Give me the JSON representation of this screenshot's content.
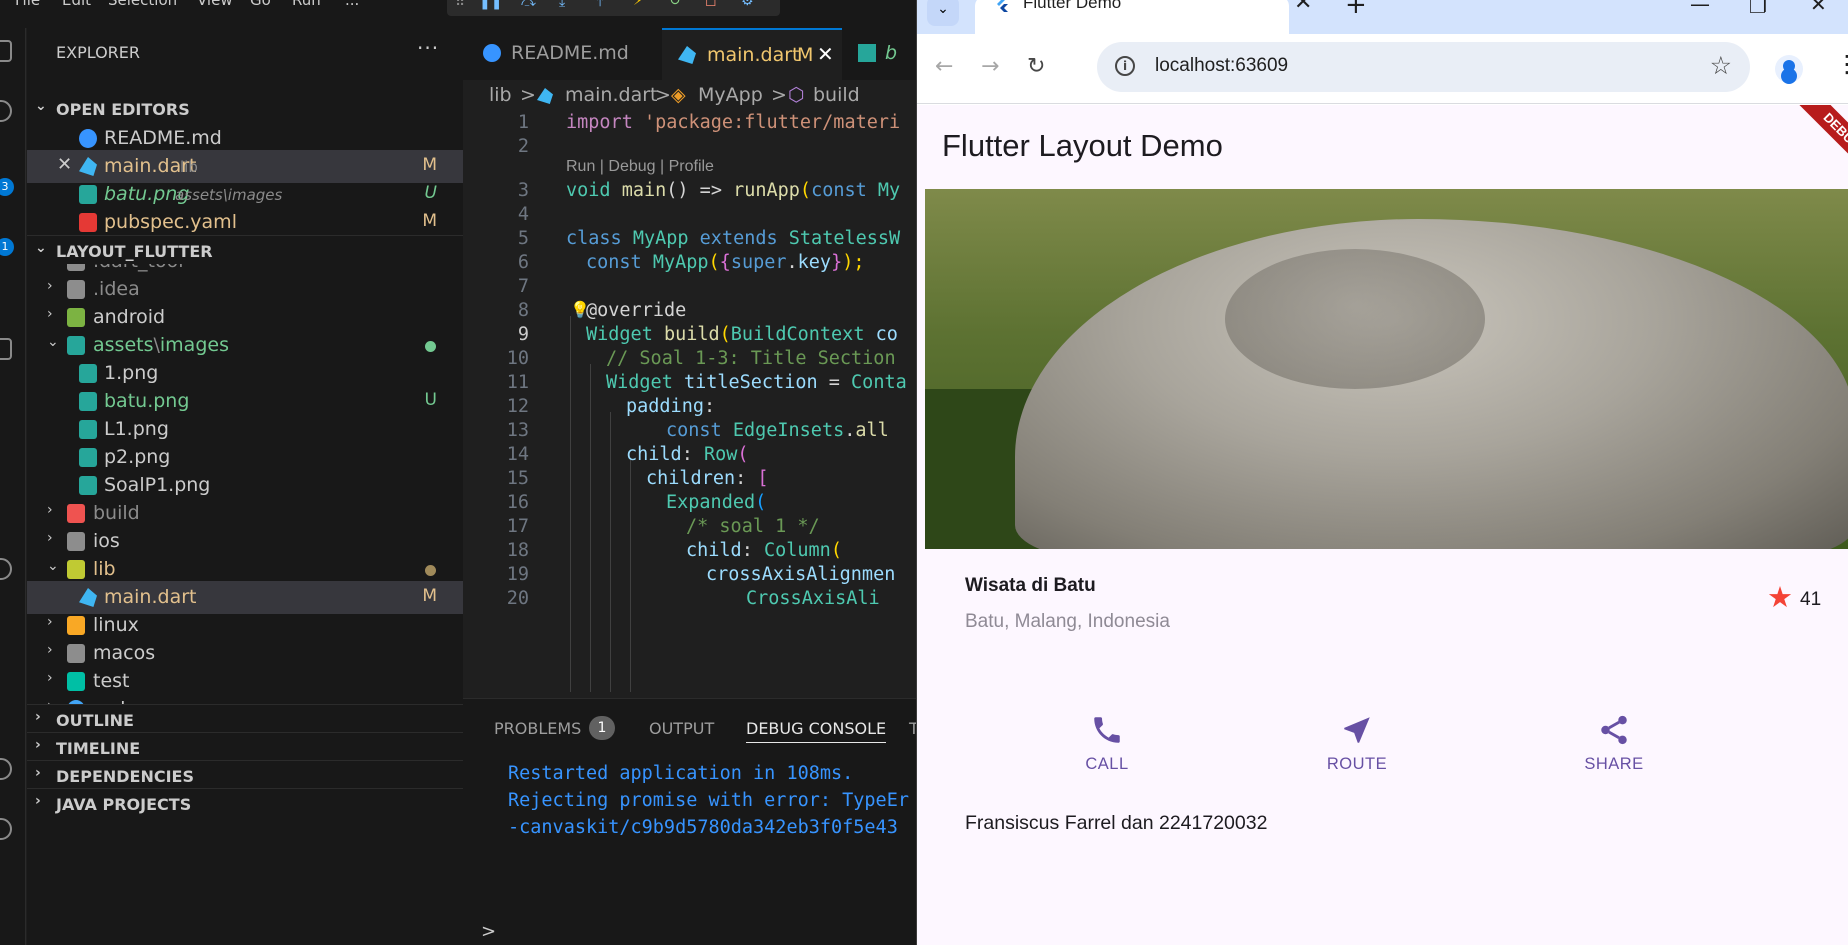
{
  "vscode": {
    "menu": [
      "File",
      "Edit",
      "Selection",
      "View",
      "Go",
      "Run",
      "..."
    ],
    "activity_badges": [
      "3",
      "1"
    ],
    "explorer_title": "EXPLORER",
    "explorer_more": "···",
    "open_editors": {
      "label": "OPEN EDITORS",
      "items": [
        {
          "name": "README.md",
          "desc": "",
          "status": "",
          "icon": "info-icon"
        },
        {
          "name": "main.dart",
          "desc": "lib",
          "status": "M",
          "icon": "dart-icon"
        },
        {
          "name": "batu.png",
          "desc": "assets\\images",
          "status": "U",
          "icon": "image-icon"
        },
        {
          "name": "pubspec.yaml",
          "desc": "",
          "status": "M",
          "icon": "yaml-icon"
        }
      ]
    },
    "project": {
      "label": "LAYOUT_FLUTTER",
      "items": [
        {
          "name": ".dart_tool"
        },
        {
          "name": ".idea"
        },
        {
          "name": "android"
        },
        {
          "name": "assets",
          "sep": "\\",
          "sub": "images"
        },
        {
          "name": "1.png"
        },
        {
          "name": "batu.png",
          "status": "U"
        },
        {
          "name": "L1.png"
        },
        {
          "name": "p2.png"
        },
        {
          "name": "SoalP1.png"
        },
        {
          "name": "build"
        },
        {
          "name": "ios"
        },
        {
          "name": "lib"
        },
        {
          "name": "main.dart",
          "status": "M"
        },
        {
          "name": "linux"
        },
        {
          "name": "macos"
        },
        {
          "name": "test"
        },
        {
          "name": "web"
        }
      ]
    },
    "bottom_sections": [
      "OUTLINE",
      "TIMELINE",
      "DEPENDENCIES",
      "JAVA PROJECTS"
    ],
    "tabs": [
      {
        "label": "README.md"
      },
      {
        "label": "main.dart",
        "status": "M"
      },
      {
        "label": "b"
      }
    ],
    "breadcrumb": [
      "lib",
      ">",
      "main.dart",
      ">",
      "MyApp",
      ">",
      "build"
    ],
    "codelens": "Run | Debug | Profile",
    "line_numbers": [
      "1",
      "2",
      "3",
      "4",
      "5",
      "6",
      "7",
      "8",
      "9",
      "10",
      "11",
      "12",
      "13",
      "14",
      "15",
      "16",
      "17",
      "18",
      "19",
      "20"
    ],
    "code": {
      "l1_kw": "import",
      "l1_str": " 'package:flutter/materi",
      "l3_ty": "void",
      "l3_fn": " main",
      "l3_a": "() => ",
      "l3_fn2": "runApp",
      "l3_b": "(",
      "l3_kw": "const",
      "l3_c": " My",
      "l5_kw": "class",
      "l5_ty": " MyApp",
      "l5_kw2": " extends",
      "l5_ty2": " StatelessW",
      "l6_kw": "const",
      "l6_ty": " MyApp",
      "l6_a": "(",
      "l6_b": "{",
      "l6_kw2": "super",
      "l6_c": ".",
      "l6_va": "key",
      "l6_d": "}",
      "l6_e": ");",
      "l8": "@override",
      "l9_ty": "Widget",
      "l9_fn": " build",
      "l9_a": "(",
      "l9_ty2": "BuildContext",
      "l9_va": " co",
      "l10": "// Soal 1-3: Title Section",
      "l11_ty": "Widget",
      "l11_va": " titleSection",
      "l11_a": " = ",
      "l11_ty2": "Conta",
      "l12_va": "padding",
      "l12_a": ":",
      "l13_kw": "const",
      "l13_ty": " EdgeInsets",
      "l13_a": ".",
      "l13_fn": "all",
      "l14_va": "child",
      "l14_a": ": ",
      "l14_ty": "Row",
      "l14_b": "(",
      "l15_va": "children",
      "l15_a": ": ",
      "l15_b": "[",
      "l16_ty": "Expanded",
      "l16_b": "(",
      "l17": "/* soal 1 */",
      "l18_va": "child",
      "l18_a": ": ",
      "l18_ty": "Column",
      "l18_b": "(",
      "l19_va": "crossAxisAlignmen",
      "l20_ty": "CrossAxisAli"
    },
    "panel": {
      "tabs": [
        "PROBLEMS",
        "OUTPUT",
        "DEBUG CONSOLE",
        "T"
      ],
      "problems_count": "1",
      "console": [
        "Restarted application in 108ms.",
        "Rejecting promise with error: TypeEr",
        "-canvaskit/c9b9d5780da342eb3f0f5e43"
      ],
      "prompt": ">"
    }
  },
  "browser": {
    "tab_title": "Flutter Demo",
    "url": "localhost:63609",
    "app": {
      "appbar_title": "Flutter Layout Demo",
      "debug_banner": "DEBUG",
      "title": "Wisata di Batu",
      "location": "Batu, Malang, Indonesia",
      "star_count": "41",
      "buttons": [
        {
          "label": "CALL",
          "icon": "phone-icon"
        },
        {
          "label": "ROUTE",
          "icon": "near-me-icon"
        },
        {
          "label": "SHARE",
          "icon": "share-icon"
        }
      ],
      "text": "Fransiscus Farrel dan 2241720032"
    },
    "accent": "#6750a4"
  }
}
